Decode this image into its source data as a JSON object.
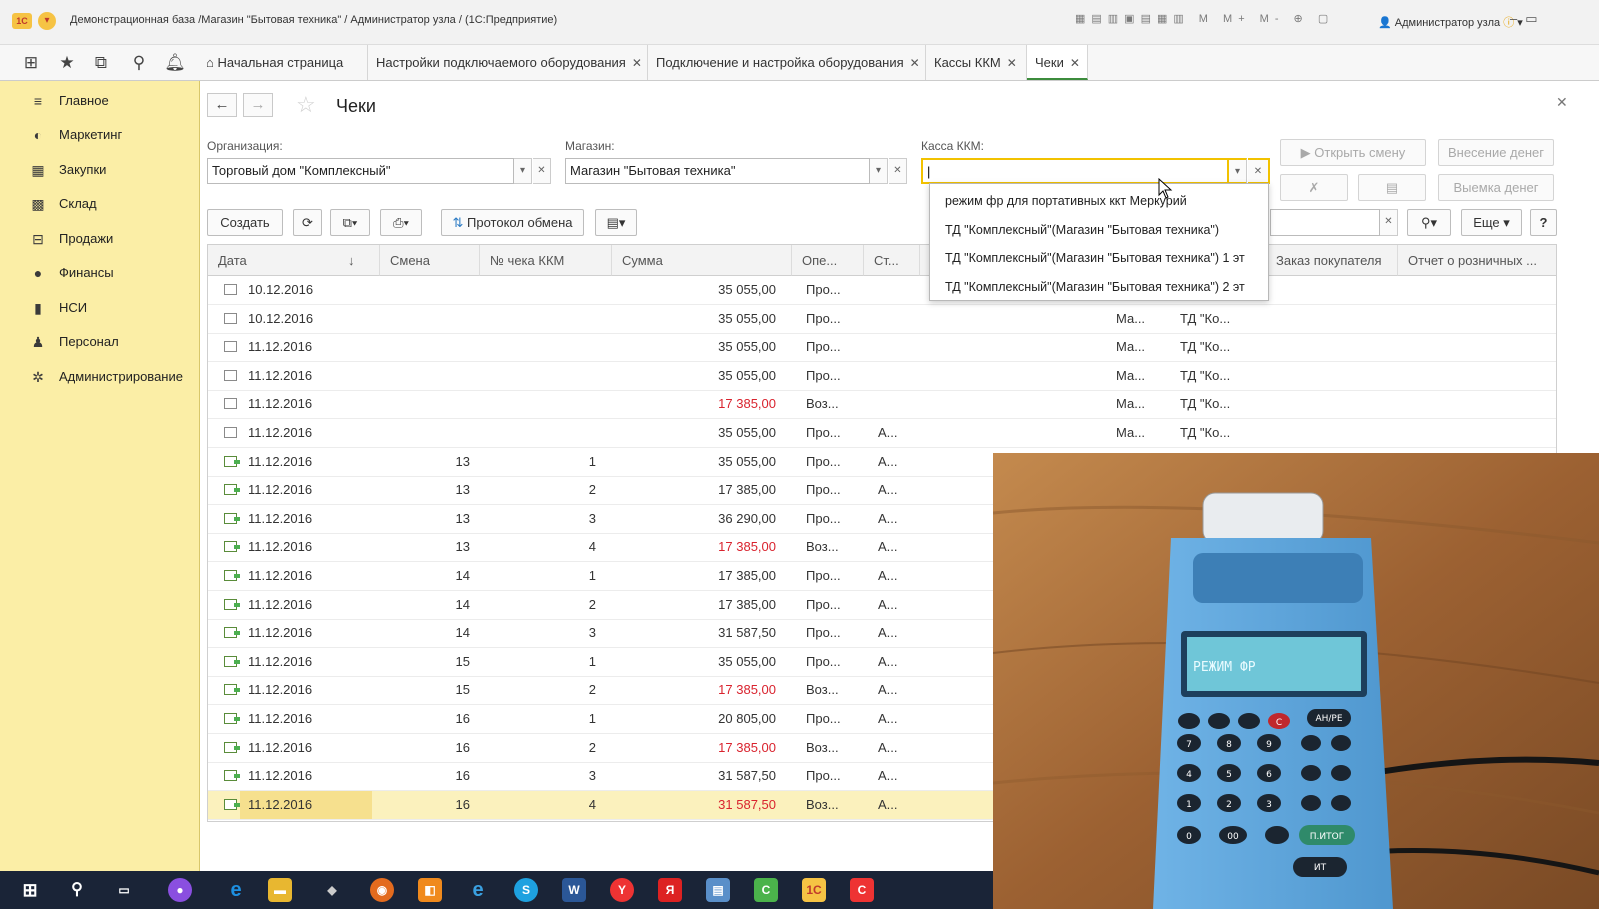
{
  "window": {
    "title": "Демонстрационная база /Магазин \"Бытовая техника\" / Администратор узла / (1С:Предприятие)",
    "user": "Администратор узла"
  },
  "tabs": [
    {
      "label": "Начальная страница",
      "closable": false
    },
    {
      "label": "Настройки подключаемого оборудования",
      "closable": true
    },
    {
      "label": "Подключение и настройка оборудования",
      "closable": true
    },
    {
      "label": "Кассы ККМ",
      "closable": true
    },
    {
      "label": "Чеки",
      "closable": true,
      "active": true
    }
  ],
  "sidebar": {
    "items": [
      {
        "label": "Главное",
        "icon": "menu-icon"
      },
      {
        "label": "Маркетинг",
        "icon": "marketing-icon"
      },
      {
        "label": "Закупки",
        "icon": "purchases-icon"
      },
      {
        "label": "Склад",
        "icon": "warehouse-icon"
      },
      {
        "label": "Продажи",
        "icon": "sales-icon"
      },
      {
        "label": "Финансы",
        "icon": "finance-icon"
      },
      {
        "label": "НСИ",
        "icon": "reference-icon"
      },
      {
        "label": "Персонал",
        "icon": "person-icon"
      },
      {
        "label": "Администрирование",
        "icon": "gear-icon"
      }
    ]
  },
  "page": {
    "title": "Чеки"
  },
  "filters": {
    "org_label": "Организация:",
    "org_value": "Торговый дом \"Комплексный\"",
    "shop_label": "Магазин:",
    "shop_value": "Магазин \"Бытовая техника\"",
    "kkm_label": "Касса ККМ:",
    "kkm_value": ""
  },
  "toolbar": {
    "create": "Создать",
    "protocol": "Протокол обмена",
    "more": "Еще",
    "help": "?"
  },
  "actions": {
    "open_shift": "Открыть смену",
    "deposit": "Внесение денег",
    "withdraw": "Выемка денег"
  },
  "dropdown": {
    "items": [
      "режим фр для портативных ккт Меркурий",
      "ТД \"Комплексный\"(Магазин \"Бытовая техника\")",
      "ТД \"Комплексный\"(Магазин \"Бытовая техника\") 1 эт",
      "ТД \"Комплексный\"(Магазин \"Бытовая техника\") 2 эт"
    ]
  },
  "table": {
    "columns": {
      "date": "Дата",
      "shift": "Смена",
      "check_no": "№ чека ККМ",
      "sum": "Сумма",
      "op": "Опе...",
      "st": "Ст...",
      "order": "Заказ покупателя",
      "report": "Отчет о розничных ..."
    },
    "sort_icon": "↓",
    "rows": [
      {
        "date": "10.12.2016",
        "shift": "",
        "check": "",
        "sum": "35 055,00",
        "op": "Про...",
        "st": "",
        "shop": "",
        "org": "",
        "neg": false,
        "icon": "doc"
      },
      {
        "date": "10.12.2016",
        "shift": "",
        "check": "",
        "sum": "35 055,00",
        "op": "Про...",
        "st": "",
        "shop": "Ма...",
        "org": "ТД \"Ко...",
        "neg": false,
        "icon": "doc"
      },
      {
        "date": "11.12.2016",
        "shift": "",
        "check": "",
        "sum": "35 055,00",
        "op": "Про...",
        "st": "",
        "shop": "Ма...",
        "org": "ТД \"Ко...",
        "neg": false,
        "icon": "doc"
      },
      {
        "date": "11.12.2016",
        "shift": "",
        "check": "",
        "sum": "35 055,00",
        "op": "Про...",
        "st": "",
        "shop": "Ма...",
        "org": "ТД \"Ко...",
        "neg": false,
        "icon": "doc"
      },
      {
        "date": "11.12.2016",
        "shift": "",
        "check": "",
        "sum": "17 385,00",
        "op": "Воз...",
        "st": "",
        "shop": "Ма...",
        "org": "ТД \"Ко...",
        "neg": true,
        "icon": "doc"
      },
      {
        "date": "11.12.2016",
        "shift": "",
        "check": "",
        "sum": "35 055,00",
        "op": "Про...",
        "st": "А...",
        "shop": "Ма...",
        "org": "ТД \"Ко...",
        "neg": false,
        "icon": "doc"
      },
      {
        "date": "11.12.2016",
        "shift": "13",
        "check": "1",
        "sum": "35 055,00",
        "op": "Про...",
        "st": "А...",
        "shop": "",
        "org": "",
        "neg": false,
        "icon": "posted"
      },
      {
        "date": "11.12.2016",
        "shift": "13",
        "check": "2",
        "sum": "17 385,00",
        "op": "Про...",
        "st": "А...",
        "shop": "",
        "org": "",
        "neg": false,
        "icon": "posted"
      },
      {
        "date": "11.12.2016",
        "shift": "13",
        "check": "3",
        "sum": "36 290,00",
        "op": "Про...",
        "st": "А...",
        "shop": "",
        "org": "",
        "neg": false,
        "icon": "posted"
      },
      {
        "date": "11.12.2016",
        "shift": "13",
        "check": "4",
        "sum": "17 385,00",
        "op": "Воз...",
        "st": "А...",
        "shop": "",
        "org": "",
        "neg": true,
        "icon": "posted"
      },
      {
        "date": "11.12.2016",
        "shift": "14",
        "check": "1",
        "sum": "17 385,00",
        "op": "Про...",
        "st": "А...",
        "shop": "",
        "org": "",
        "neg": false,
        "icon": "posted"
      },
      {
        "date": "11.12.2016",
        "shift": "14",
        "check": "2",
        "sum": "17 385,00",
        "op": "Про...",
        "st": "А...",
        "shop": "",
        "org": "",
        "neg": false,
        "icon": "posted"
      },
      {
        "date": "11.12.2016",
        "shift": "14",
        "check": "3",
        "sum": "31 587,50",
        "op": "Про...",
        "st": "А...",
        "shop": "",
        "org": "",
        "neg": false,
        "icon": "posted"
      },
      {
        "date": "11.12.2016",
        "shift": "15",
        "check": "1",
        "sum": "35 055,00",
        "op": "Про...",
        "st": "А...",
        "shop": "",
        "org": "",
        "neg": false,
        "icon": "posted"
      },
      {
        "date": "11.12.2016",
        "shift": "15",
        "check": "2",
        "sum": "17 385,00",
        "op": "Воз...",
        "st": "А...",
        "shop": "",
        "org": "",
        "neg": true,
        "icon": "posted"
      },
      {
        "date": "11.12.2016",
        "shift": "16",
        "check": "1",
        "sum": "20 805,00",
        "op": "Про...",
        "st": "А...",
        "shop": "",
        "org": "",
        "neg": false,
        "icon": "posted"
      },
      {
        "date": "11.12.2016",
        "shift": "16",
        "check": "2",
        "sum": "17 385,00",
        "op": "Воз...",
        "st": "А...",
        "shop": "",
        "org": "",
        "neg": true,
        "icon": "posted"
      },
      {
        "date": "11.12.2016",
        "shift": "16",
        "check": "3",
        "sum": "31 587,50",
        "op": "Про...",
        "st": "А...",
        "shop": "",
        "org": "",
        "neg": false,
        "icon": "posted"
      },
      {
        "date": "11.12.2016",
        "shift": "16",
        "check": "4",
        "sum": "31 587,50",
        "op": "Воз...",
        "st": "А...",
        "shop": "",
        "org": "",
        "neg": true,
        "icon": "posted",
        "selected": true
      }
    ]
  },
  "device_photo": {
    "display_text": "РЕЖИМ ФР",
    "keys": [
      "АН/РЕ",
      "П.ИТОГ",
      "ИТ",
      "00",
      "0",
      "1",
      "2",
      "3",
      "4",
      "5",
      "6",
      "7",
      "8",
      "9",
      "С"
    ]
  },
  "taskbar": {
    "apps": [
      "windows-start-icon",
      "search-icon",
      "task-view-icon",
      "app-icon",
      "edge-icon",
      "explorer-icon",
      "app-icon",
      "firefox-icon",
      "app-icon",
      "ie-icon",
      "skype-icon",
      "word-icon",
      "app-icon",
      "yandex-icon",
      "app-icon",
      "app-icon",
      "1c-icon",
      "app-icon"
    ]
  },
  "colors": {
    "sidebar_bg": "#fbeea6",
    "accent_green": "#3c8c3c",
    "negative": "#d9232e",
    "focus_yellow": "#f2c200",
    "selected_row": "#fbf1bd"
  }
}
